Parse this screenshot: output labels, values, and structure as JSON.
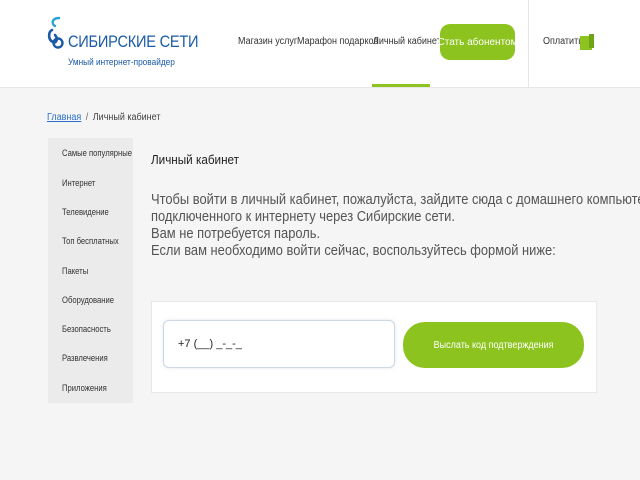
{
  "brand": {
    "name": "СИБИРСКИЕ СЕТИ",
    "tagline": "Умный интернет-провайдер",
    "color": "#1a5aa6"
  },
  "nav": {
    "items": [
      {
        "label": "Магазин услуг"
      },
      {
        "label": "Марафон подарков"
      },
      {
        "label": "Личный кабинет",
        "active": true
      }
    ],
    "subscribe_label": "Стать абонентом",
    "pay_label": "Оплатить"
  },
  "breadcrumb": {
    "home": "Главная",
    "separator": "/",
    "current": "Личный кабинет"
  },
  "sidebar": {
    "items": [
      {
        "label": "Самые популярные"
      },
      {
        "label": "Интернет"
      },
      {
        "label": "Телевидение"
      },
      {
        "label": "Топ бесплатных"
      },
      {
        "label": "Пакеты"
      },
      {
        "label": "Оборудование"
      },
      {
        "label": "Безопасность"
      },
      {
        "label": "Развлечения"
      },
      {
        "label": "Приложения"
      }
    ]
  },
  "main": {
    "title": "Личный кабинет",
    "info_lines": [
      "Чтобы войти в личный кабинет, пожалуйста, зайдите сюда с домашнего компьютера",
      "подключенного к интернету через Сибирские сети.",
      "Вам не потребуется пароль.",
      "Если вам необходимо войти сейчас, воспользуйтесь формой ниже:"
    ],
    "phone_value": "+7 (__) _-_-_",
    "send_button_label": "Выслать код подтверждения"
  },
  "colors": {
    "accent": "#8cc31e",
    "link": "#2a6fc9",
    "background": "#f5f5f5"
  }
}
